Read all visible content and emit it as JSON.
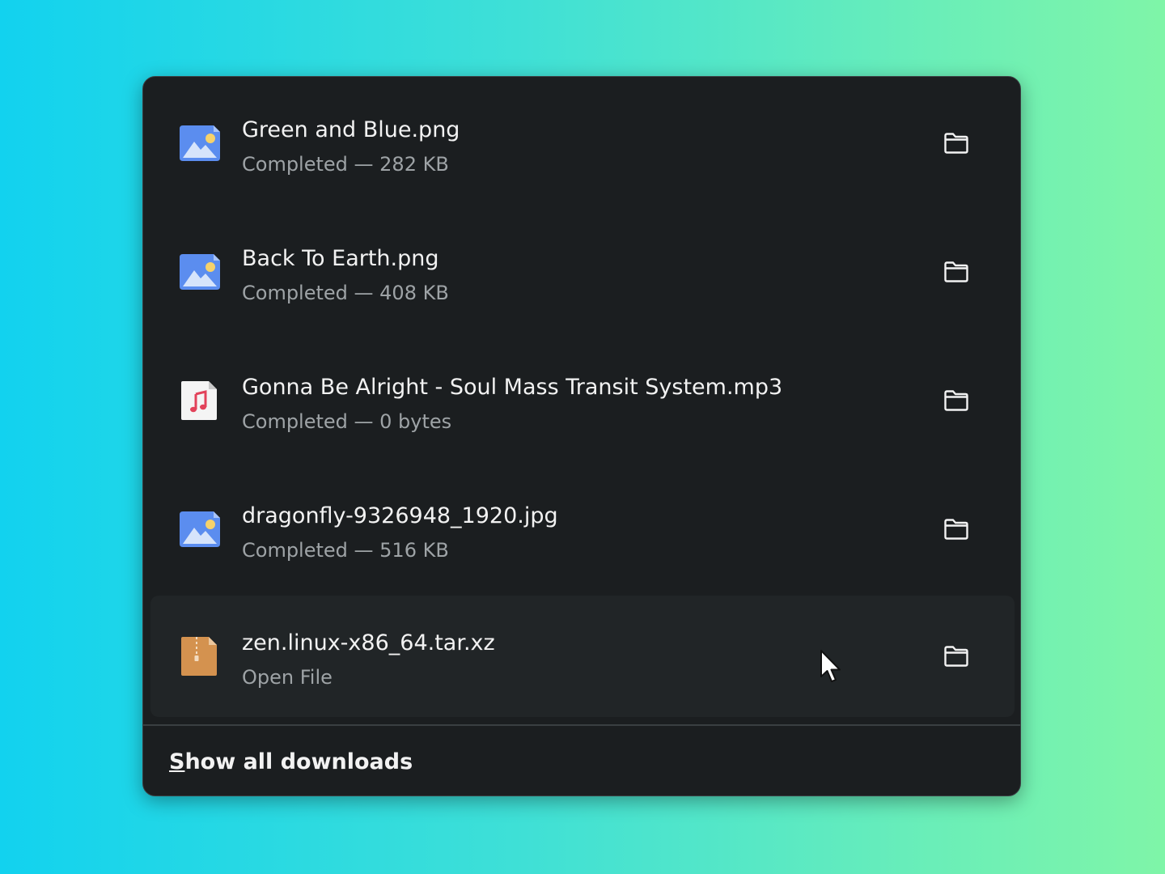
{
  "downloads": [
    {
      "filename": "Green and Blue.png",
      "status": "Completed — 282 KB",
      "icon": "image-file-icon"
    },
    {
      "filename": "Back To Earth.png",
      "status": "Completed — 408 KB",
      "icon": "image-file-icon"
    },
    {
      "filename": "Gonna Be Alright - Soul Mass Transit System.mp3",
      "status": "Completed — 0 bytes",
      "icon": "audio-file-icon"
    },
    {
      "filename": "dragonfly-9326948_1920.jpg",
      "status": "Completed — 516 KB",
      "icon": "image-file-icon"
    },
    {
      "filename": "zen.linux-x86_64.tar.xz",
      "status": "Open File",
      "icon": "archive-file-icon"
    }
  ],
  "footer": {
    "show_all_first": "S",
    "show_all_rest": "how all downloads"
  },
  "colors": {
    "panel_bg": "#1b1e20",
    "hover_bg": "#212527",
    "text_primary": "#f2f2f2",
    "text_secondary": "#9ea3a6",
    "image_icon_blue": "#5b8def",
    "archive_icon_orange": "#d4924f",
    "audio_note_red": "#e2425a"
  }
}
